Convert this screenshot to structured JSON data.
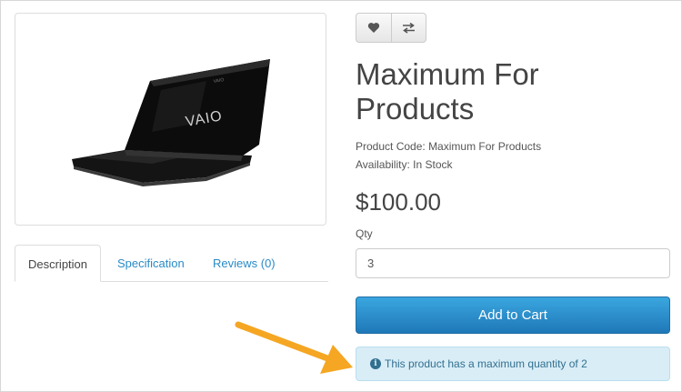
{
  "product": {
    "title": "Maximum For Products",
    "code_label": "Product Code:",
    "code_value": "Maximum For Products",
    "availability_label": "Availability:",
    "availability_value": "In Stock",
    "price": "$100.00",
    "image_brand": "VAIO"
  },
  "actions": {
    "wishlist_icon": "heart-icon",
    "compare_icon": "exchange-icon"
  },
  "tabs": [
    {
      "label": "Description",
      "active": true
    },
    {
      "label": "Specification",
      "active": false
    },
    {
      "label": "Reviews (0)",
      "active": false
    }
  ],
  "form": {
    "qty_label": "Qty",
    "qty_value": "3",
    "add_to_cart_label": "Add to Cart"
  },
  "alert": {
    "icon": "info-circle-icon",
    "message": "This product has a maximum quantity of 2"
  },
  "colors": {
    "accent_blue": "#2a8bc7",
    "button_blue": "#229ac8",
    "alert_bg": "#d9edf7",
    "alert_text": "#31708f",
    "annotation_arrow": "#f5a623"
  }
}
